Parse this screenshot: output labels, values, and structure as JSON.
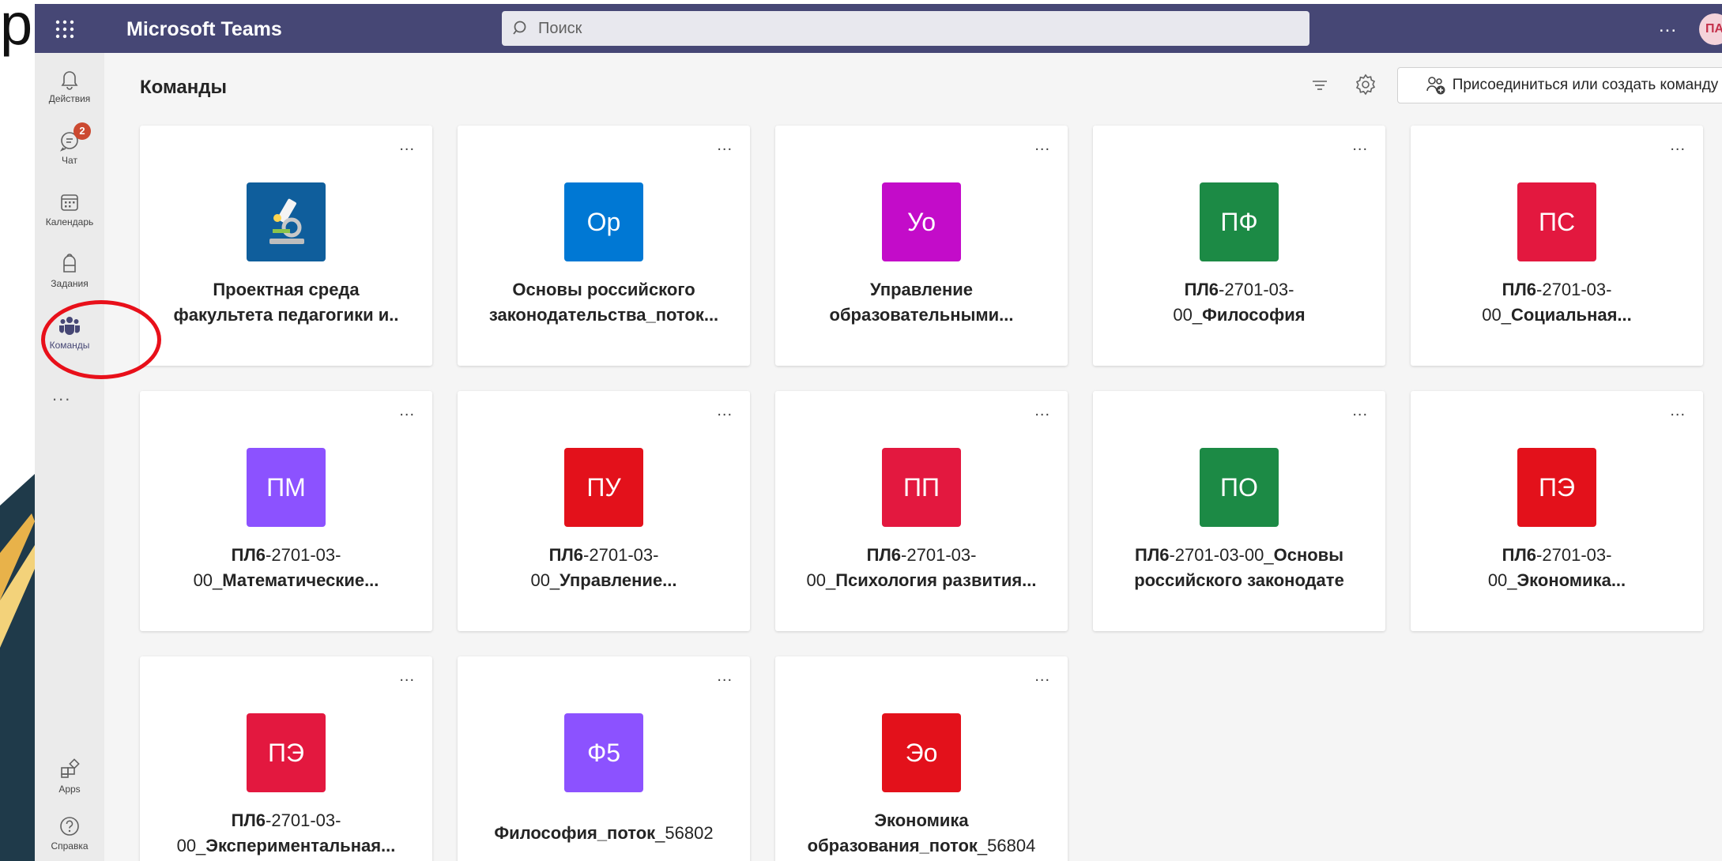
{
  "slide": {
    "letter": "р"
  },
  "topbar": {
    "app_title": "Microsoft Teams",
    "search_placeholder": "Поиск",
    "more": "...",
    "avatar_initials": "ПА"
  },
  "rail": {
    "items": [
      {
        "label": "Действия",
        "icon": "bell-icon"
      },
      {
        "label": "Чат",
        "icon": "chat-icon",
        "badge": "2"
      },
      {
        "label": "Календарь",
        "icon": "calendar-icon"
      },
      {
        "label": "Задания",
        "icon": "backpack-icon"
      },
      {
        "label": "Команды",
        "icon": "teams-icon",
        "active": true
      }
    ],
    "more": "...",
    "bottom": [
      {
        "label": "Apps",
        "icon": "apps-icon"
      },
      {
        "label": "Справка",
        "icon": "help-icon"
      }
    ]
  },
  "main": {
    "title": "Команды",
    "join_button": "Присоединиться или создать команду"
  },
  "cards": [
    {
      "tile": "",
      "tile_color": "#0f5e9c",
      "image": "microscope",
      "l1": [
        [
          "Проектная среда",
          true
        ]
      ],
      "l2": [
        [
          "факультета педагогики и..",
          true
        ]
      ]
    },
    {
      "tile": "Ор",
      "tile_color": "#0078d4",
      "l1": [
        [
          "Основы российского",
          true
        ]
      ],
      "l2": [
        [
          "законодательства_поток...",
          true
        ]
      ]
    },
    {
      "tile": "Уо",
      "tile_color": "#c30cc9",
      "l1": [
        [
          "Управление",
          true
        ]
      ],
      "l2": [
        [
          "образовательными...",
          true
        ]
      ]
    },
    {
      "tile": "ПФ",
      "tile_color": "#1c8a45",
      "l1": [
        [
          "ПЛ6",
          true
        ],
        [
          "-2701-03-",
          false
        ]
      ],
      "l2": [
        [
          "00_",
          false
        ],
        [
          "Философия",
          true
        ]
      ]
    },
    {
      "tile": "ПС",
      "tile_color": "#e3183f",
      "l1": [
        [
          "ПЛ6",
          true
        ],
        [
          "-2701-03-",
          false
        ]
      ],
      "l2": [
        [
          "00_",
          false
        ],
        [
          "Социальная...",
          true
        ]
      ]
    },
    {
      "tile": "ПМ",
      "tile_color": "#8c52ff",
      "l1": [
        [
          "ПЛ6",
          true
        ],
        [
          "-2701-03-",
          false
        ]
      ],
      "l2": [
        [
          "00_",
          false
        ],
        [
          "Математические...",
          true
        ]
      ]
    },
    {
      "tile": "ПУ",
      "tile_color": "#e3111b",
      "l1": [
        [
          "ПЛ6",
          true
        ],
        [
          "-2701-03-",
          false
        ]
      ],
      "l2": [
        [
          "00_",
          false
        ],
        [
          "Управление...",
          true
        ]
      ]
    },
    {
      "tile": "ПП",
      "tile_color": "#e3183f",
      "l1": [
        [
          "ПЛ6",
          true
        ],
        [
          "-2701-03-",
          false
        ]
      ],
      "l2": [
        [
          "00_",
          false
        ],
        [
          "Психология развития...",
          true
        ]
      ]
    },
    {
      "tile": "ПО",
      "tile_color": "#1c8a45",
      "l1": [
        [
          "ПЛ6",
          true
        ],
        [
          "-2701-03-00_",
          false
        ],
        [
          "Основы",
          true
        ]
      ],
      "l2": [
        [
          "российского законодате",
          true
        ]
      ]
    },
    {
      "tile": "ПЭ",
      "tile_color": "#e3111b",
      "l1": [
        [
          "ПЛ6",
          true
        ],
        [
          "-2701-03-",
          false
        ]
      ],
      "l2": [
        [
          "00_",
          false
        ],
        [
          "Экономика...",
          true
        ]
      ]
    },
    {
      "tile": "ПЭ",
      "tile_color": "#e3183f",
      "l1": [
        [
          "ПЛ6",
          true
        ],
        [
          "-2701-03-",
          false
        ]
      ],
      "l2": [
        [
          "00_",
          false
        ],
        [
          "Экспериментальная...",
          true
        ]
      ]
    },
    {
      "tile": "Ф5",
      "tile_color": "#8c52ff",
      "l1": [],
      "l2": [
        [
          "Философия_поток",
          true
        ],
        [
          "_56802",
          false
        ]
      ]
    },
    {
      "tile": "Эо",
      "tile_color": "#e3111b",
      "l1": [
        [
          "Экономика",
          true
        ]
      ],
      "l2": [
        [
          "образования_поток",
          true
        ],
        [
          "_56804",
          false
        ]
      ]
    }
  ]
}
